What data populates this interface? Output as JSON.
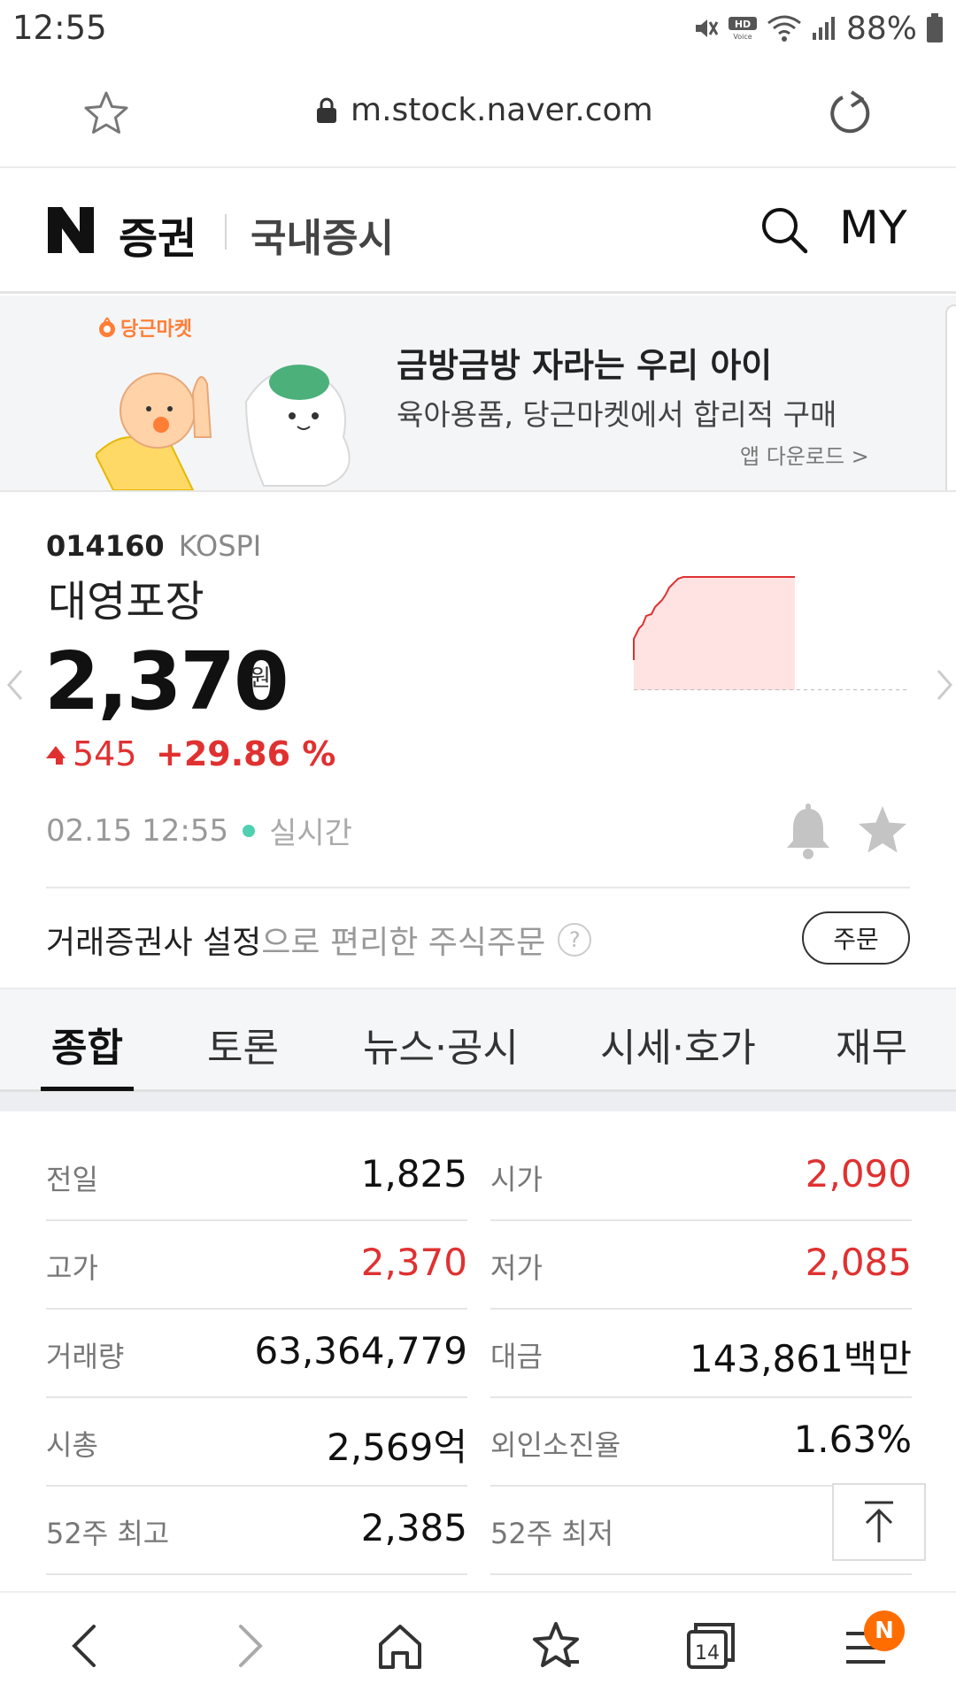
{
  "status_bar": {
    "time": "12:55",
    "battery": "88%"
  },
  "browser": {
    "url": "m.stock.naver.com"
  },
  "header": {
    "logo": "N",
    "title": "증권",
    "section": "국내증시",
    "my_label": "MY"
  },
  "ad": {
    "brand": "당근마켓",
    "title": "금방금방 자라는 우리 아이",
    "subtitle": "육아용품, 당근마켓에서 합리적 구매",
    "cta": "앱 다운로드 >"
  },
  "stock": {
    "code": "014160",
    "market": "KOSPI",
    "name": "대영포장",
    "price": "2,370",
    "unit": "원",
    "change": "545",
    "change_rate": "+29.86 %",
    "timestamp": "02.15 12:55",
    "live_label": "실시간",
    "colors": {
      "up": "#e03131",
      "live": "#4fd0b0"
    }
  },
  "order": {
    "text_bold": "거래증권사 설정",
    "text_rest": "으로 편리한 주식주문",
    "help": "?",
    "button": "주문"
  },
  "tabs": [
    {
      "label": "종합",
      "active": true
    },
    {
      "label": "토론",
      "active": false
    },
    {
      "label": "뉴스·공시",
      "active": false
    },
    {
      "label": "시세·호가",
      "active": false
    },
    {
      "label": "재무",
      "active": false
    }
  ],
  "info": {
    "left": [
      {
        "label": "전일",
        "value": "1,825",
        "red": false
      },
      {
        "label": "고가",
        "value": "2,370",
        "red": true
      },
      {
        "label": "거래량",
        "value": "63,364,779",
        "red": false
      },
      {
        "label": "시총",
        "value": "2,569억",
        "red": false
      },
      {
        "label": "52주 최고",
        "value": "2,385",
        "red": false
      }
    ],
    "right": [
      {
        "label": "시가",
        "value": "2,090",
        "red": true
      },
      {
        "label": "저가",
        "value": "2,085",
        "red": true
      },
      {
        "label": "대금",
        "value": "143,861백만",
        "red": false
      },
      {
        "label": "외인소진율",
        "value": "1.63%",
        "red": false
      },
      {
        "label": "52주 최저",
        "value": "",
        "red": false
      }
    ]
  },
  "bottom_nav": {
    "tab_count": "14",
    "badge": "N"
  }
}
